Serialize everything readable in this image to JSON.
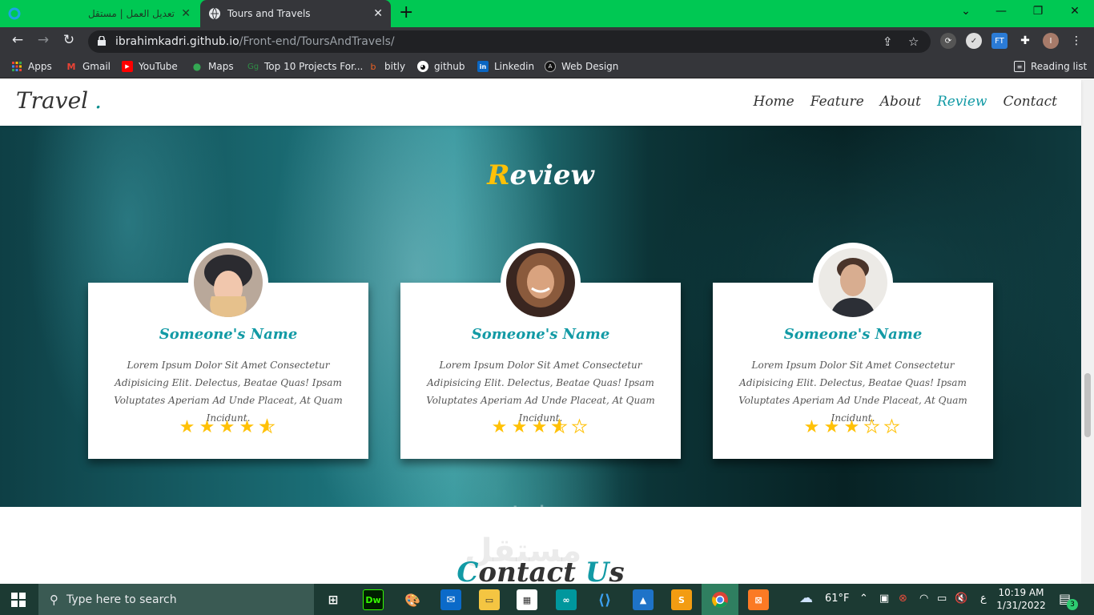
{
  "browser": {
    "tabs": [
      {
        "label": "تعديل العمل | مستقل",
        "active": false
      },
      {
        "label": "Tours and Travels",
        "active": true
      }
    ],
    "url_host": "ibrahimkadri.github.io",
    "url_path": "/Front-end/ToursAndTravels/",
    "profile_initial": "I",
    "ext_badge": "FT",
    "bookmarks": [
      {
        "label": "Apps",
        "icon": "apps-grid-icon"
      },
      {
        "label": "Gmail",
        "icon": "gmail-icon"
      },
      {
        "label": "YouTube",
        "icon": "youtube-icon"
      },
      {
        "label": "Maps",
        "icon": "maps-icon"
      },
      {
        "label": "Top 10 Projects For...",
        "icon": "geeks-icon"
      },
      {
        "label": "bitly",
        "icon": "bitly-icon"
      },
      {
        "label": "github",
        "icon": "github-icon"
      },
      {
        "label": "Linkedin",
        "icon": "linkedin-icon"
      },
      {
        "label": "Web Design",
        "icon": "webdesign-icon"
      }
    ],
    "reading_list": "Reading list",
    "tab_strip_color": "#00c853"
  },
  "site": {
    "logo": "Travel",
    "logo_dot": ".",
    "nav": [
      "Home",
      "Feature",
      "About",
      "Review",
      "Contact"
    ],
    "active_nav": "Review",
    "review_title_cap": "R",
    "review_title_rest": "eview",
    "cards": [
      {
        "name": "Someone's Name",
        "text": "Lorem Ipsum Dolor Sit Amet Consectetur Adipisicing Elit. Delectus, Beatae Quas! Ipsam Voluptates Aperiam Ad Unde Placeat, At Quam Incidunt.",
        "rating": 4.5
      },
      {
        "name": "Someone's Name",
        "text": "Lorem Ipsum Dolor Sit Amet Consectetur Adipisicing Elit. Delectus, Beatae Quas! Ipsam Voluptates Aperiam Ad Unde Placeat, At Quam Incidunt.",
        "rating": 3.5
      },
      {
        "name": "Someone's Name",
        "text": "Lorem Ipsum Dolor Sit Amet Consectetur Adipisicing Elit. Delectus, Beatae Quas! Ipsam Voluptates Aperiam Ad Unde Placeat, At Quam Incidunt.",
        "rating": 3
      }
    ],
    "contact_title_cap1": "C",
    "contact_title_mid": "ontact ",
    "contact_title_cap2": "U",
    "contact_title_end": "s",
    "accent_color": "#129aa5",
    "star_color": "#ffc107"
  },
  "watermark": {
    "arabic": "مستقل",
    "latin": "mostaql.com"
  },
  "taskbar": {
    "search_placeholder": "Type here to search",
    "weather": "61°F",
    "time": "10:19 AM",
    "date": "1/31/2022",
    "lang": "ع",
    "notifications": "3",
    "apps": [
      "task-view-icon",
      "dreamweaver-icon",
      "paint-icon",
      "mail-icon",
      "explorer-icon",
      "store-icon",
      "arduino-icon",
      "vscode-icon",
      "photos-icon",
      "sublime-icon",
      "chrome-icon",
      "xampp-icon"
    ]
  }
}
